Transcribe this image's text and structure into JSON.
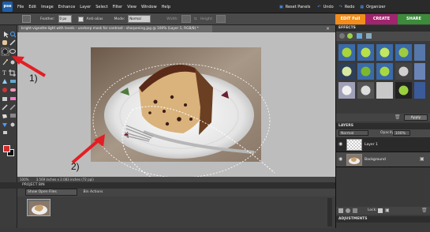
{
  "app": {
    "logo": "pse",
    "menu": [
      "File",
      "Edit",
      "Image",
      "Enhance",
      "Layer",
      "Select",
      "Filter",
      "View",
      "Window",
      "Help"
    ],
    "top_actions": [
      "Reset Panels",
      "Undo",
      "Redo",
      "Organizer"
    ],
    "modes": [
      "EDIT Full",
      "CREATE",
      "SHARE"
    ]
  },
  "options_bar": {
    "feather_label": "Feather:",
    "feather_value": "0 px",
    "antialias_label": "Anti-alias",
    "mode_label": "Mode:",
    "mode_value": "Normal",
    "width_label": "Width:",
    "height_label": "Height:"
  },
  "document": {
    "tab_title": "bright-vignette-light with levels - unsharp mask for contrast - sharpening.jpg @ 100% (Layer 1, RGB/8) *",
    "zoom": "100%",
    "doc_info": "3.569 inches x 2.083 inches (72 ppi)"
  },
  "annotations": {
    "label1": "1)",
    "label2": "2)"
  },
  "project_bin": {
    "title": "PROJECT BIN",
    "show_label": "Show Open Files",
    "bin_actions": "Bin Actions"
  },
  "effects_panel": {
    "title": "EFFECTS",
    "apply_label": "Apply"
  },
  "layers_panel": {
    "title": "LAYERS",
    "blend_mode": "Normal",
    "opacity_label": "Opacity:",
    "opacity_value": "100%",
    "lock_label": "Lock:",
    "layers": [
      {
        "name": "Layer 1"
      },
      {
        "name": "Background"
      }
    ]
  },
  "adjustments_panel": {
    "title": "ADJUSTMENTS"
  },
  "colors": {
    "foreground": "#d42b2b",
    "background": "#111111",
    "edit_mode": "#f28c1b",
    "create_mode": "#a0246e",
    "share_mode": "#3c8a3a",
    "arrow": "#e31e24"
  }
}
